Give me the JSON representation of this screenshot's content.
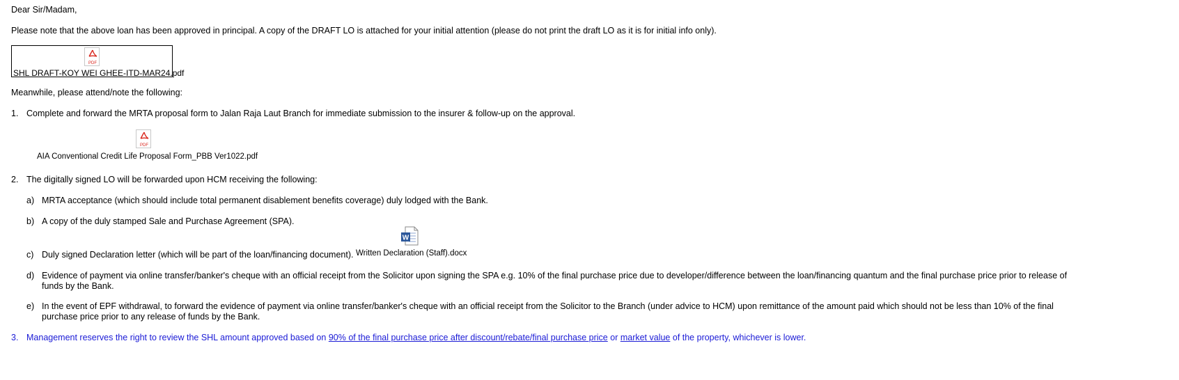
{
  "greeting": "Dear Sir/Madam,",
  "intro": "Please note that the above loan has been approved in principal.  A copy of the DRAFT LO is attached for your initial attention (please do not print the draft LO as it is for initial info only).",
  "attachment_main": {
    "filename": "SHL DRAFT-KOY WEI GHEE-ITD-MAR24.pdf",
    "icon_label": "PDF"
  },
  "meanwhile": "Meanwhile, please attend/note the following:",
  "items": [
    {
      "num": "1.",
      "text": "Complete and forward the MRTA proposal form to Jalan Raja Laut Branch for immediate submission to the insurer & follow-up on the approval."
    },
    {
      "num": "2.",
      "text": "The digitally signed LO will be forwarded upon HCM receiving the following:"
    },
    {
      "num": "3.",
      "text_before": "Management reserves the right to review the SHL amount approved based on ",
      "link1": "90% of the final purchase price after discount/rebate/final purchase price",
      "text_mid": " or ",
      "link2": "market value",
      "text_after": " of the property, whichever is lower."
    }
  ],
  "attachment_form": {
    "filename": "AIA Conventional Credit Life Proposal Form_PBB Ver1022.pdf",
    "icon_label": "PDF"
  },
  "subitems": [
    {
      "letter": "a)",
      "text": "MRTA acceptance (which should include total permanent disablement benefits coverage) duly lodged with the Bank."
    },
    {
      "letter": "b)",
      "text": "A copy of the duly stamped Sale and Purchase Agreement (SPA)."
    },
    {
      "letter": "c)",
      "text": "Duly signed Declaration letter (which will be part of the loan/financing document)."
    },
    {
      "letter": "d)",
      "text": "Evidence of payment via online transfer/banker's cheque with an official receipt from the Solicitor upon signing the SPA e.g. 10% of the final purchase price due to developer/difference between the loan/financing quantum and the final purchase price prior to release of funds by the Bank."
    },
    {
      "letter": "e)",
      "text": "In the event of EPF withdrawal, to forward the evidence of payment via online transfer/banker's cheque with an official receipt from the Solicitor to the Branch (under advice to HCM) upon remittance of the amount paid which should not be less than 10% of the final purchase price prior to any release of funds by the Bank."
    }
  ],
  "attachment_declaration": {
    "filename": "Written Declaration (Staff).docx",
    "icon_label": "W"
  },
  "colors": {
    "link_blue": "#1a1ad6",
    "pdf_red": "#d9261c",
    "word_blue": "#2b579a"
  }
}
